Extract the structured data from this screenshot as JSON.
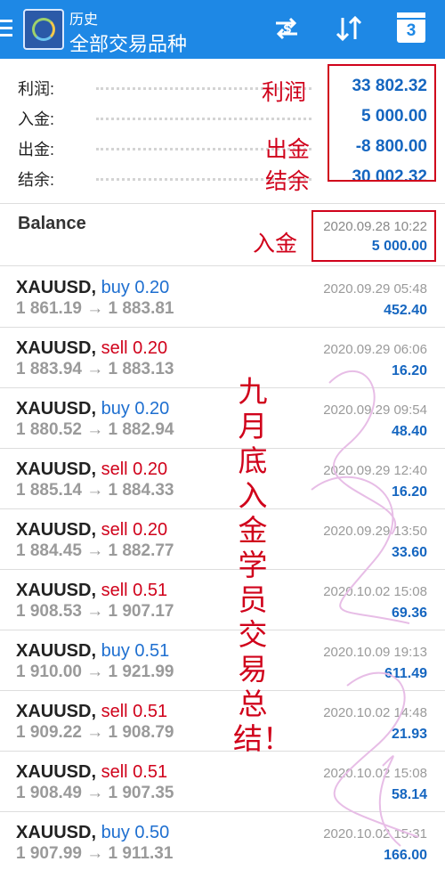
{
  "header": {
    "subtitle": "历史",
    "title": "全部交易品种",
    "calendar_day": "3"
  },
  "summary": [
    {
      "label": "利润:",
      "value": "33 802.32"
    },
    {
      "label": "入金:",
      "value": "5 000.00"
    },
    {
      "label": "出金:",
      "value": "-8 800.00"
    },
    {
      "label": "结余:",
      "value": "30 002.32"
    }
  ],
  "annotations": {
    "profit": "利润",
    "withdraw": "出金",
    "balance": "结余",
    "deposit": "入金",
    "vertical": "九月底入金学员交易总结！"
  },
  "balance_entry": {
    "title": "Balance",
    "time": "2020.09.28 10:22",
    "amount": "5 000.00"
  },
  "trades": [
    {
      "symbol": "XAUUSD,",
      "side": "buy 0.20",
      "type": "buy",
      "prices": "1 861.19 → 1 883.81",
      "time": "2020.09.29 05:48",
      "profit": "452.40"
    },
    {
      "symbol": "XAUUSD,",
      "side": "sell 0.20",
      "type": "sell",
      "prices": "1 883.94 → 1 883.13",
      "time": "2020.09.29 06:06",
      "profit": "16.20"
    },
    {
      "symbol": "XAUUSD,",
      "side": "buy 0.20",
      "type": "buy",
      "prices": "1 880.52 → 1 882.94",
      "time": "2020.09.29 09:54",
      "profit": "48.40"
    },
    {
      "symbol": "XAUUSD,",
      "side": "sell 0.20",
      "type": "sell",
      "prices": "1 885.14 → 1 884.33",
      "time": "2020.09.29 12:40",
      "profit": "16.20"
    },
    {
      "symbol": "XAUUSD,",
      "side": "sell 0.20",
      "type": "sell",
      "prices": "1 884.45 → 1 882.77",
      "time": "2020.09.29 13:50",
      "profit": "33.60"
    },
    {
      "symbol": "XAUUSD,",
      "side": "sell 0.51",
      "type": "sell",
      "prices": "1 908.53 → 1 907.17",
      "time": "2020.10.02 15:08",
      "profit": "69.36"
    },
    {
      "symbol": "XAUUSD,",
      "side": "buy 0.51",
      "type": "buy",
      "prices": "1 910.00 → 1 921.99",
      "time": "2020.10.09 19:13",
      "profit": "611.49"
    },
    {
      "symbol": "XAUUSD,",
      "side": "sell 0.51",
      "type": "sell",
      "prices": "1 909.22 → 1 908.79",
      "time": "2020.10.02 14:48",
      "profit": "21.93"
    },
    {
      "symbol": "XAUUSD,",
      "side": "sell 0.51",
      "type": "sell",
      "prices": "1 908.49 → 1 907.35",
      "time": "2020.10.02 15:08",
      "profit": "58.14"
    },
    {
      "symbol": "XAUUSD,",
      "side": "buy 0.50",
      "type": "buy",
      "prices": "1 907.99 → 1 911.31",
      "time": "2020.10.02 15:31",
      "profit": "166.00"
    }
  ]
}
